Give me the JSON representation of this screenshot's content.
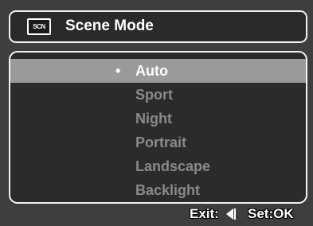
{
  "header": {
    "icon_text": "SCN",
    "title": "Scene Mode"
  },
  "menu": {
    "selected_index": 0,
    "items": [
      {
        "label": "Auto"
      },
      {
        "label": "Sport"
      },
      {
        "label": "Night"
      },
      {
        "label": "Portrait"
      },
      {
        "label": "Landscape"
      },
      {
        "label": "Backlight"
      }
    ],
    "bullet": "•"
  },
  "footer": {
    "exit_label": "Exit:",
    "set_label": "Set:OK"
  },
  "colors": {
    "background": "#3e3e3e",
    "highlight": "#9a9a9a",
    "inactive_text": "#8a8a8a",
    "active_text": "#ffffff"
  }
}
